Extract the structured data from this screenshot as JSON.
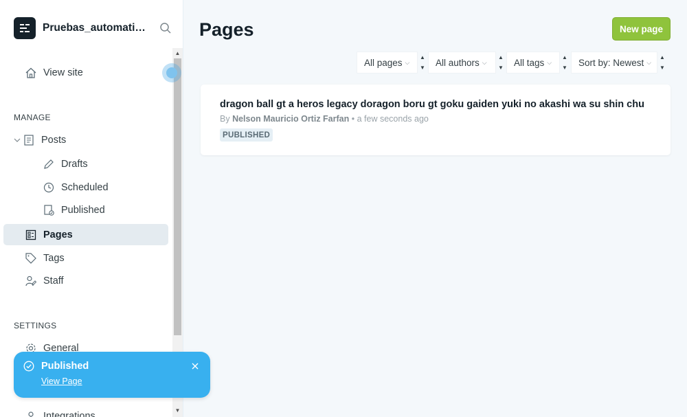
{
  "sidebar": {
    "site_name": "Pruebas_automatic...",
    "view_site": "View site",
    "manage_label": "MANAGE",
    "settings_label": "SETTINGS",
    "items": {
      "posts": "Posts",
      "drafts": "Drafts",
      "scheduled": "Scheduled",
      "published": "Published",
      "pages": "Pages",
      "tags": "Tags",
      "staff": "Staff",
      "general": "General",
      "integrations": "Integrations"
    }
  },
  "main": {
    "title": "Pages",
    "new_page_label": "New page",
    "filters": {
      "type": "All pages",
      "authors": "All authors",
      "tags": "All tags",
      "sort": "Sort by: Newest"
    },
    "pages": [
      {
        "title": "dragon ball gt a heros legacy doragon boru gt goku gaiden yuki no akashi wa su shin chu",
        "by": "By",
        "author": "Nelson Mauricio Ortiz Farfan",
        "separator": "•",
        "time": "a few seconds ago",
        "status": "PUBLISHED"
      }
    ]
  },
  "toast": {
    "title": "Published",
    "link": "View Page"
  },
  "colors": {
    "accent_green": "#8fc33c",
    "toast_blue": "#38b0ef",
    "active_bg": "#e4ebf0"
  }
}
